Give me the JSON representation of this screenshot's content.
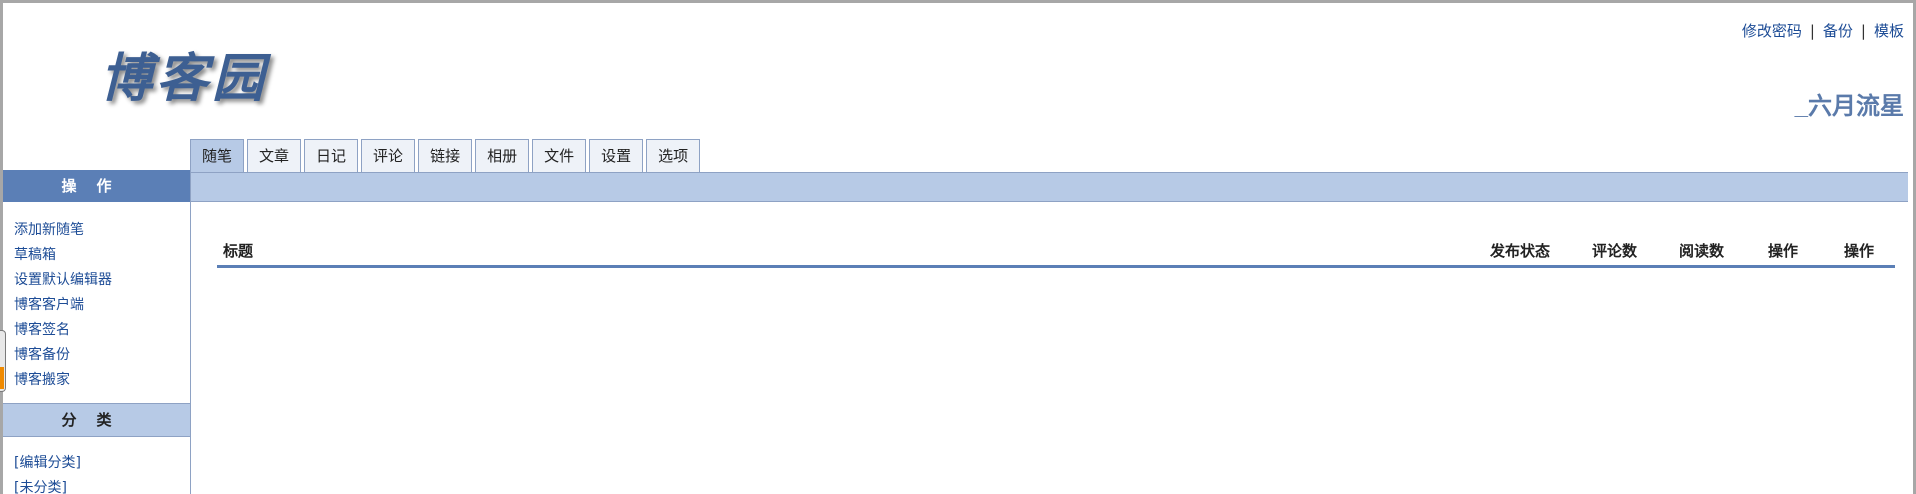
{
  "logo": {
    "text": "博客园"
  },
  "top_links": [
    {
      "label": "修改密码"
    },
    {
      "label": "备份"
    },
    {
      "label": "模板"
    }
  ],
  "blog_name": "_六月流星",
  "tabs": [
    {
      "label": "随笔",
      "active": true
    },
    {
      "label": "文章"
    },
    {
      "label": "日记"
    },
    {
      "label": "评论"
    },
    {
      "label": "链接"
    },
    {
      "label": "相册"
    },
    {
      "label": "文件"
    },
    {
      "label": "设置"
    },
    {
      "label": "选项"
    }
  ],
  "sidebar": {
    "ops_title": "操作",
    "ops_items": [
      {
        "label": "添加新随笔"
      },
      {
        "label": "草稿箱"
      },
      {
        "label": "设置默认编辑器"
      },
      {
        "label": "博客客户端"
      },
      {
        "label": "博客签名"
      },
      {
        "label": "博客备份"
      },
      {
        "label": "博客搬家"
      }
    ],
    "cat_title": "分类",
    "cat_items": [
      {
        "label": "[编辑分类]"
      },
      {
        "label": "[未分类]"
      }
    ]
  },
  "table": {
    "columns": {
      "title": "标题",
      "status": "发布状态",
      "comments": "评论数",
      "reads": "阅读数",
      "op1": "操作",
      "op2": "操作"
    }
  },
  "colors": {
    "accent": "#5b7fb6",
    "tab_bar": "#b7cae6",
    "link": "#1d4c96",
    "blog_name": "#5a7aaa"
  }
}
